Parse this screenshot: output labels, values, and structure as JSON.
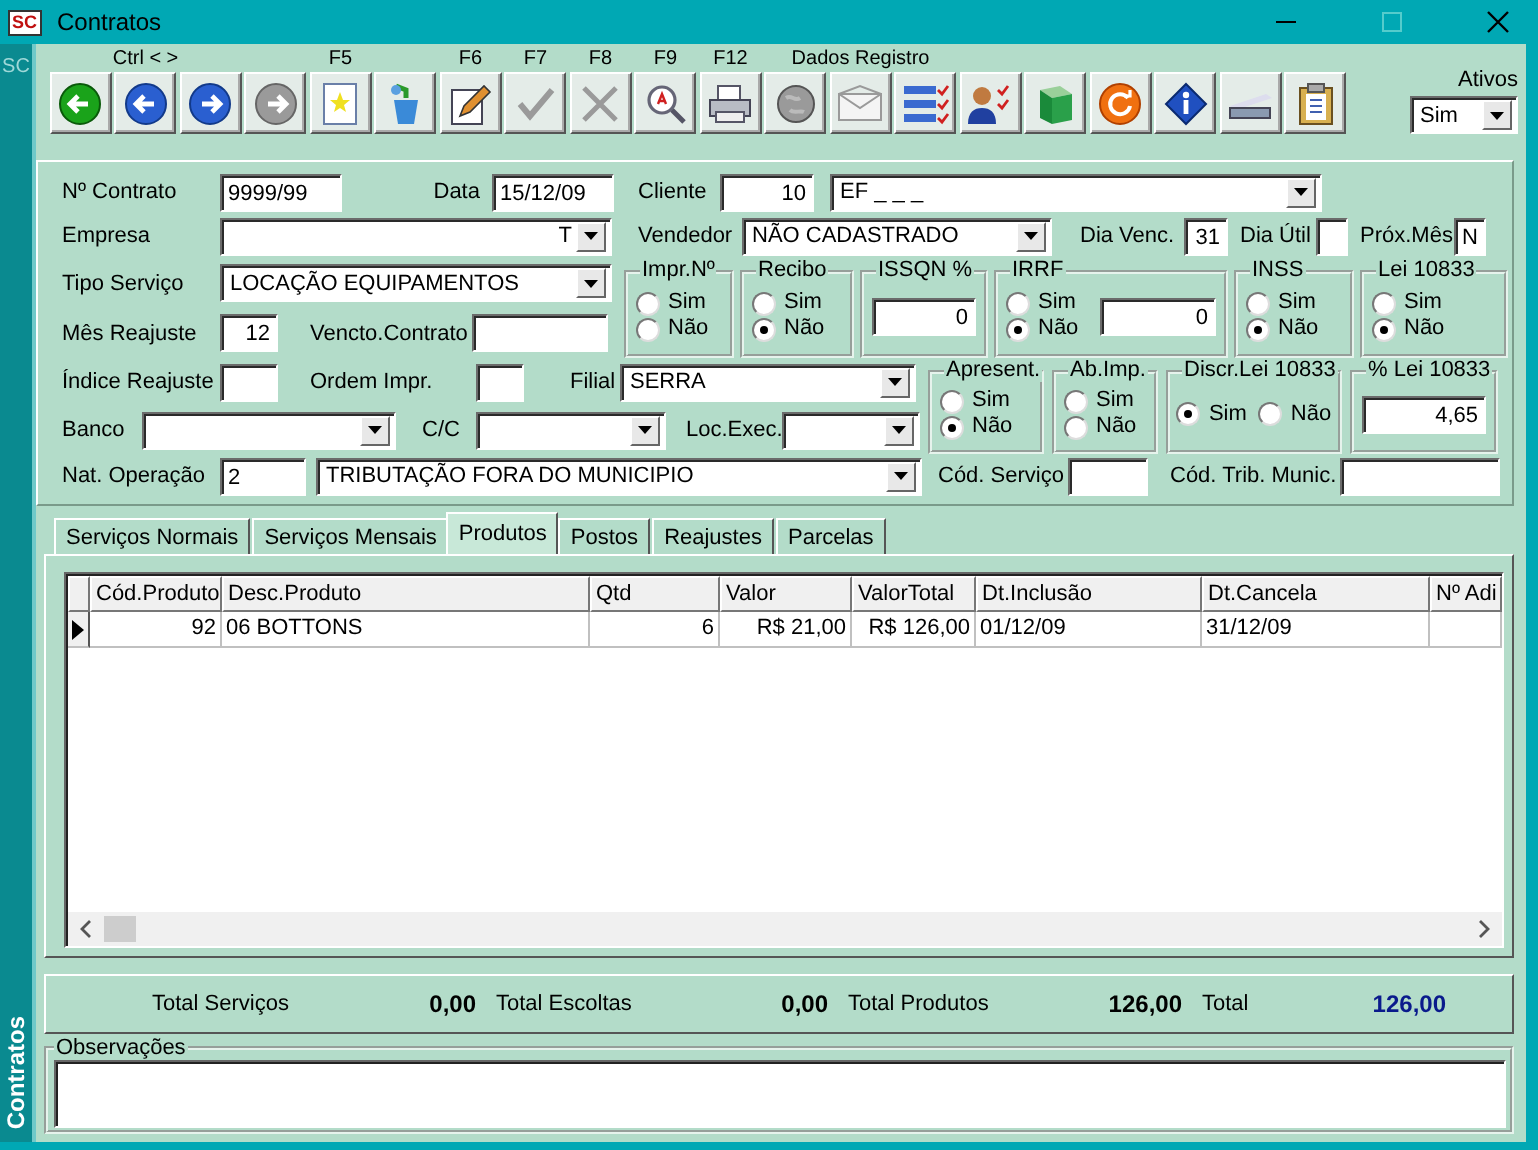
{
  "window": {
    "title": "Contratos",
    "app_badge": "SC"
  },
  "side_strip": {
    "top_label": "SC",
    "bottom_label": "Contratos"
  },
  "toolbar": {
    "buttons": [
      {
        "disabled": false
      },
      {
        "key": "Ctrl < >",
        "disabled": false
      },
      {
        "disabled": false
      },
      {
        "disabled": true
      },
      {
        "key": "F5",
        "disabled": false
      },
      {
        "disabled": false
      },
      {
        "key": "F6",
        "disabled": false
      },
      {
        "key": "F7",
        "disabled": true
      },
      {
        "key": "F8",
        "disabled": true
      },
      {
        "key": "F9",
        "disabled": false
      },
      {
        "key": "F12",
        "disabled": false
      },
      {
        "disabled": true
      },
      {
        "key": "Dados Registro",
        "disabled": true
      },
      {
        "disabled": false
      },
      {
        "disabled": false
      },
      {
        "disabled": false
      },
      {
        "disabled": false
      },
      {
        "disabled": false
      },
      {
        "disabled": false
      },
      {
        "disabled": false
      }
    ],
    "active_filter": {
      "label": "Ativos",
      "value": "Sim"
    }
  },
  "form": {
    "contract_no": {
      "label": "Nº Contrato",
      "value": "9999/99"
    },
    "date": {
      "label": "Data",
      "value": "15/12/09"
    },
    "client": {
      "label": "Cliente",
      "code": "10",
      "name": "EF _ _ _"
    },
    "company": {
      "label": "Empresa",
      "value": "T"
    },
    "seller": {
      "label": "Vendedor",
      "value": "NÃO CADASTRADO"
    },
    "due_day": {
      "label": "Dia Venc.",
      "value": "31"
    },
    "business_day": {
      "label": "Dia Útil"
    },
    "next_month": {
      "label": "Próx.Mês",
      "value": "N"
    },
    "service_type": {
      "label": "Tipo Serviço",
      "value": "LOCAÇÃO EQUIPAMENTOS"
    },
    "adjust_month": {
      "label": "Mês Reajuste",
      "value": "12"
    },
    "contract_due": {
      "label": "Vencto.Contrato"
    },
    "adjust_index": {
      "label": "Índice Reajuste"
    },
    "print_order": {
      "label": "Ordem Impr."
    },
    "branch": {
      "label": "Filial",
      "value": "SERRA"
    },
    "bank": {
      "label": "Banco"
    },
    "account": {
      "label": "C/C"
    },
    "exec_place": {
      "label": "Loc.Exec."
    },
    "operation": {
      "label": "Nat. Operação",
      "code": "2",
      "name": "TRIBUTAÇÃO FORA DO MUNICIPIO"
    },
    "service_code": {
      "label": "Cód. Serviço"
    },
    "tax_code": {
      "label": "Cód. Trib. Munic."
    },
    "groups_top": [
      {
        "kind": "radio",
        "title": "Impr.Nº",
        "options": [
          {
            "label": "Sim",
            "selected": false
          },
          {
            "label": "Não",
            "selected": false
          }
        ]
      },
      {
        "kind": "radio",
        "title": "Recibo",
        "options": [
          {
            "label": "Sim",
            "selected": false
          },
          {
            "label": "Não",
            "selected": true
          }
        ]
      },
      {
        "kind": "field",
        "title": "ISSQN %",
        "value": "0"
      },
      {
        "kind": "radio_field",
        "title": "IRRF",
        "options": [
          {
            "label": "Sim",
            "selected": false
          },
          {
            "label": "Não",
            "selected": true
          }
        ],
        "value": "0"
      },
      {
        "kind": "radio",
        "title": "INSS",
        "options": [
          {
            "label": "Sim",
            "selected": false
          },
          {
            "label": "Não",
            "selected": true
          }
        ]
      },
      {
        "kind": "radio",
        "title": "Lei 10833",
        "options": [
          {
            "label": "Sim",
            "selected": false
          },
          {
            "label": "Não",
            "selected": true
          }
        ]
      }
    ],
    "groups_bottom": [
      {
        "kind": "radio",
        "title": "Apresent.",
        "options": [
          {
            "label": "Sim",
            "selected": false
          },
          {
            "label": "Não",
            "selected": true
          }
        ]
      },
      {
        "kind": "radio",
        "title": "Ab.Imp.",
        "options": [
          {
            "label": "Sim",
            "selected": false
          },
          {
            "label": "Não",
            "selected": false
          }
        ]
      },
      {
        "kind": "radio_inline",
        "title": "Discr.Lei 10833",
        "options": [
          {
            "label": "Sim",
            "selected": true
          },
          {
            "label": "Não",
            "selected": false
          }
        ]
      },
      {
        "kind": "field",
        "title": "% Lei 10833",
        "value": "4,65"
      }
    ]
  },
  "tabs": [
    {
      "label": "Serviços Normais",
      "selected": false
    },
    {
      "label": "Serviços Mensais",
      "selected": false
    },
    {
      "label": "Produtos",
      "selected": true
    },
    {
      "label": "Postos",
      "selected": false
    },
    {
      "label": "Reajustes",
      "selected": false
    },
    {
      "label": "Parcelas",
      "selected": false
    }
  ],
  "table": {
    "columns": [
      "Cód.Produto",
      "Desc.Produto",
      "Qtd",
      "Valor",
      "ValorTotal",
      "Dt.Inclusão",
      "Dt.Cancela",
      "Nº Adi"
    ],
    "rows": [
      {
        "current": true,
        "cells": [
          "92",
          "06 BOTTONS",
          "6",
          "R$ 21,00",
          "R$ 126,00",
          "01/12/09",
          "31/12/09",
          null
        ]
      }
    ]
  },
  "totals": [
    {
      "label": "Total Serviços",
      "value": "0,00",
      "kind": "subtotal"
    },
    {
      "label": "Total Escoltas",
      "value": "0,00",
      "kind": "subtotal"
    },
    {
      "label": "Total Produtos",
      "value": "126,00",
      "kind": "subtotal"
    },
    {
      "label": "Total",
      "value": "126,00",
      "kind": "grand"
    }
  ],
  "notes": {
    "label": "Observações"
  }
}
